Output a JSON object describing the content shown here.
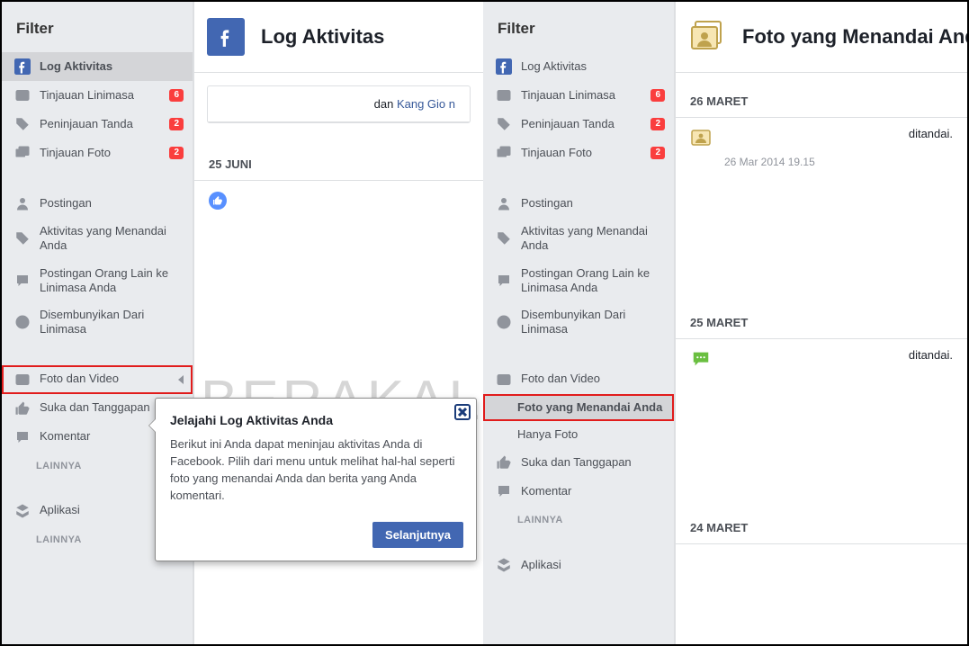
{
  "watermark": "BERAKAL",
  "left": {
    "sidebar": {
      "header": "Filter",
      "items": {
        "log": {
          "label": "Log Aktivitas"
        },
        "timelineReview": {
          "label": "Tinjauan Linimasa",
          "badge": "6"
        },
        "tagReview": {
          "label": "Peninjauan Tanda",
          "badge": "2"
        },
        "photoReview": {
          "label": "Tinjauan Foto",
          "badge": "2"
        },
        "posts": {
          "label": "Postingan"
        },
        "tagged": {
          "label": "Aktivitas yang Menandai Anda"
        },
        "othersPosts": {
          "label": "Postingan Orang Lain ke Linimasa Anda"
        },
        "hidden": {
          "label": "Disembunyikan Dari Linimasa"
        },
        "photosVideos": {
          "label": "Foto dan Video"
        },
        "likes": {
          "label": "Suka dan Tanggapan"
        },
        "comments": {
          "label": "Komentar"
        },
        "more1": {
          "label": "LAINNYA"
        },
        "apps": {
          "label": "Aplikasi"
        },
        "more2": {
          "label": "LAINNYA"
        }
      }
    },
    "main": {
      "title": "Log Aktivitas",
      "snippet_prefix": "dan ",
      "snippet_link": "Kang Gio n",
      "dateHead": "25 JUNI"
    },
    "popover": {
      "title": "Jelajahi Log Aktivitas Anda",
      "body": "Berikut ini Anda dapat meninjau aktivitas Anda di Facebook. Pilih dari menu untuk melihat hal-hal seperti foto yang menandai Anda dan berita yang Anda komentari.",
      "button": "Selanjutnya"
    }
  },
  "right": {
    "sidebar": {
      "header": "Filter",
      "items": {
        "log": {
          "label": "Log Aktivitas"
        },
        "timelineReview": {
          "label": "Tinjauan Linimasa",
          "badge": "6"
        },
        "tagReview": {
          "label": "Peninjauan Tanda",
          "badge": "2"
        },
        "photoReview": {
          "label": "Tinjauan Foto",
          "badge": "2"
        },
        "posts": {
          "label": "Postingan"
        },
        "tagged": {
          "label": "Aktivitas yang Menandai Anda"
        },
        "othersPosts": {
          "label": "Postingan Orang Lain ke Linimasa Anda"
        },
        "hidden": {
          "label": "Disembunyikan Dari Linimasa"
        },
        "photosVideos": {
          "label": "Foto dan Video"
        },
        "photosTagging": {
          "label": "Foto yang Menandai Anda"
        },
        "onlyPhotos": {
          "label": "Hanya Foto"
        },
        "likes": {
          "label": "Suka dan Tanggapan"
        },
        "comments": {
          "label": "Komentar"
        },
        "more1": {
          "label": "LAINNYA"
        },
        "apps": {
          "label": "Aplikasi"
        }
      }
    },
    "main": {
      "title": "Foto yang Menandai Anda",
      "sections": [
        {
          "date": "26 MARET",
          "entry": {
            "txt": "ditandai.",
            "ts": "26 Mar 2014 19.15",
            "thumb": "photo"
          }
        },
        {
          "date": "25 MARET",
          "entry": {
            "txt": "ditandai.",
            "thumb": "comment"
          }
        },
        {
          "date": "24 MARET"
        }
      ]
    }
  }
}
